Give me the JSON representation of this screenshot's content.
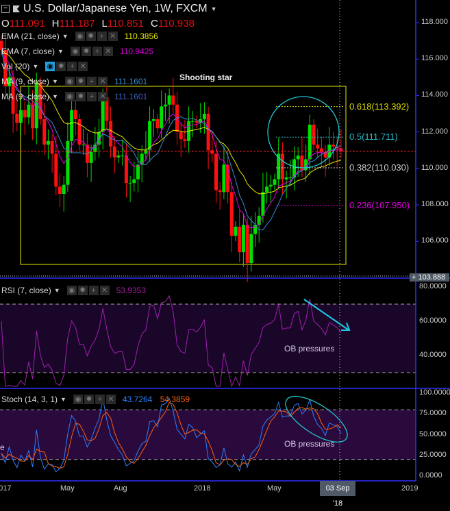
{
  "header": {
    "title": "U.S. Dollar/Japanese Yen, 1W, FXCM",
    "open_label": "O",
    "open": "111.091",
    "high_label": "H",
    "high": "111.187",
    "low_label": "L",
    "low": "110.851",
    "close_label": "C",
    "close": "110.938"
  },
  "indicators": [
    {
      "label": "EMA (21, close)",
      "value": "110.3856",
      "color": "#e8e800"
    },
    {
      "label": "EMA (7, close)",
      "value": "110.9425",
      "color": "#e000e0"
    },
    {
      "label": "Vol (20)",
      "value": "",
      "color": "#ddd"
    },
    {
      "label": "MA (9, close)",
      "value": "111.1601",
      "color": "#3a8ed0"
    },
    {
      "label": "MA (9, close)",
      "value": "111.1601",
      "color": "#3a5fc0"
    }
  ],
  "rsi": {
    "label": "RSI (7, close)",
    "value": "53.9353",
    "ticks": [
      "80.0000",
      "60.0000",
      "40.0000"
    ]
  },
  "stoch": {
    "label": "Stoch (14, 3, 1)",
    "k": "43.7264",
    "d": "54.3859",
    "ticks": [
      "100.0000",
      "75.0000",
      "50.0000",
      "25.0000",
      "0.0000"
    ]
  },
  "price_axis": {
    "ticks": [
      "118.000",
      "116.000",
      "114.000",
      "112.000",
      "110.000",
      "108.000",
      "106.000"
    ],
    "tag": "103.888"
  },
  "time_axis": {
    "labels": [
      "2017",
      "May",
      "Aug",
      "2018",
      "May",
      "2019"
    ],
    "cursor": "03 Sep '18"
  },
  "annotations": {
    "shooting_star": "Shooting star",
    "ob_rsi": "OB pressures",
    "ob_stoch": "OB pressures",
    "stoch_cut": "e"
  },
  "fib": [
    {
      "label": "0.618(113.392)",
      "price": 113.392,
      "color": "#d8d800"
    },
    {
      "label": "0.5(111.711)",
      "price": 111.711,
      "color": "#20c0c8"
    },
    {
      "label": "0.382(110.030)",
      "price": 110.03,
      "color": "#cccccc"
    },
    {
      "label": "0.236(107.950)",
      "price": 107.95,
      "color": "#e000e0"
    }
  ],
  "chart_data": {
    "type": "candlestick",
    "title": "U.S. Dollar/Japanese Yen, 1W, FXCM",
    "closes": [
      116.5,
      114.5,
      115,
      113,
      112.5,
      113.2,
      112.8,
      113.5,
      112.2,
      114.7,
      112.7,
      111.3,
      111.5,
      110.8,
      109,
      108.6,
      109.1,
      111.5,
      113.2,
      112.7,
      111.3,
      111.3,
      110.3,
      110.9,
      111.3,
      112.0,
      113.9,
      112.6,
      111.2,
      110.6,
      110.7,
      110.7,
      109.2,
      109.2,
      109.4,
      110.2,
      110.8,
      111.0,
      112.6,
      112.7,
      112.2,
      113.4,
      113.5,
      114.0,
      113.5,
      112.0,
      111.6,
      111.5,
      112.6,
      112.6,
      112.5,
      112.7,
      113.0,
      111.0,
      110.8,
      108.8,
      108.7,
      110.2,
      108.7,
      106.3,
      106.8,
      105.4,
      106.9,
      104.8,
      106.4,
      106.9,
      107.4,
      108.7,
      109.0,
      109.1,
      109.4,
      110.8,
      109.4,
      109.5,
      109.5,
      110.5,
      110.7,
      109.9,
      110.5,
      112.4,
      111.3,
      111.1,
      110.9,
      110.6,
      111.3,
      111.2,
      111.1,
      110.938
    ],
    "current_price": 110.938,
    "ylim": [
      103.888,
      118.6
    ],
    "rsi_levels": [
      70,
      30
    ],
    "stoch_levels": [
      80,
      20
    ]
  },
  "colors": {
    "up": "#00e000",
    "down": "#ff1010",
    "bg": "#000000",
    "axis": "#3030ff",
    "band": "#1a0628",
    "stoch_band": "#2a0a3c"
  }
}
